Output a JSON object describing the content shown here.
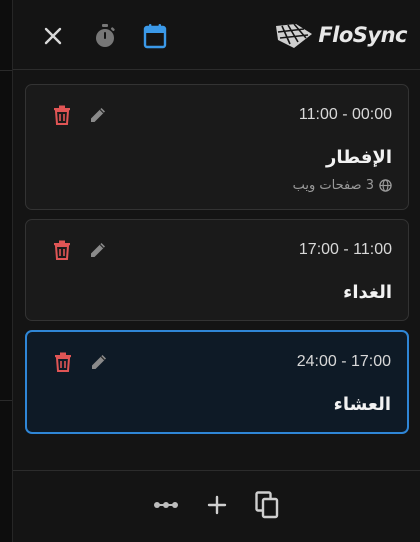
{
  "app": {
    "logo_text": "FloSync"
  },
  "header": {
    "icons": [
      "close-icon",
      "timer-icon",
      "calendar-icon"
    ],
    "active_icon": "calendar-icon"
  },
  "colors": {
    "accent": "#2f86d6",
    "trash": "#e05555",
    "active_icon": "#3b99e8"
  },
  "entries": [
    {
      "time": "11:00 - 00:00",
      "title": "الإفطار",
      "meta": "3 صفحات ويب",
      "selected": false
    },
    {
      "time": "17:00 - 11:00",
      "title": "الغداء",
      "selected": false
    },
    {
      "time": "24:00 - 17:00",
      "title": "العشاء",
      "selected": true
    }
  ],
  "footer": {
    "icons": [
      "more-icon",
      "add-icon",
      "copy-icon"
    ]
  }
}
